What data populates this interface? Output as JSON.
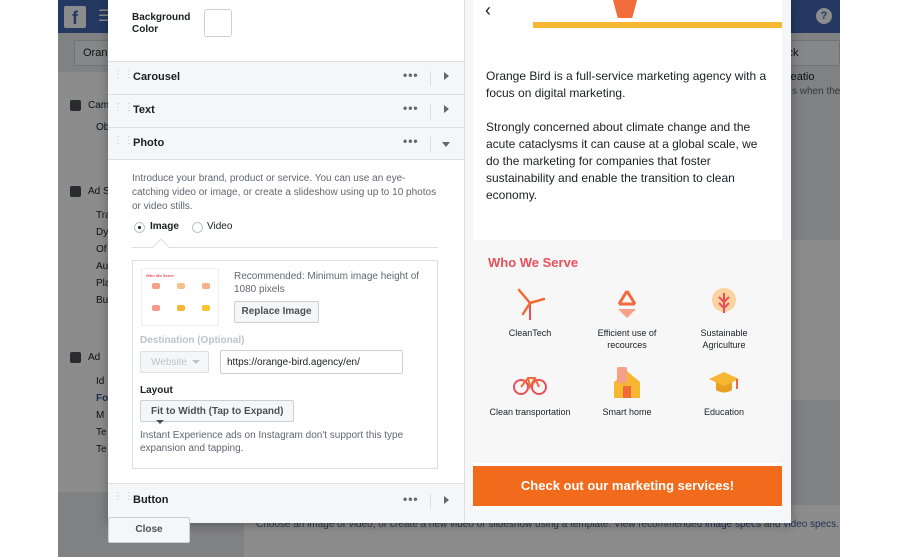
{
  "background": {
    "tab_label": "Orang",
    "quick_label": "uick Creatio",
    "side_items": [
      {
        "label": "Cam",
        "checked": true
      },
      {
        "label": "Ob",
        "checked": false
      },
      {
        "label": "Ad S",
        "checked": true
      },
      {
        "label": "Tra",
        "checked": false
      },
      {
        "label": "Dy",
        "checked": false
      },
      {
        "label": "Of",
        "checked": false
      },
      {
        "label": "Au",
        "checked": false
      },
      {
        "label": "Pla",
        "checked": false
      },
      {
        "label": "Bu",
        "checked": false
      },
      {
        "label": "Ad",
        "checked": true
      },
      {
        "label": "Id",
        "checked": false
      },
      {
        "label": "Fo",
        "checked": false
      },
      {
        "label": "M",
        "checked": false
      },
      {
        "label": "Te",
        "checked": false
      },
      {
        "label": "Te",
        "checked": false
      }
    ],
    "right_snippet": "s when the",
    "bottom_text": "Choose an image or video, or create a new video or slideshow using a template. View recommended ",
    "bottom_link1": "image specs",
    "bottom_and": " and ",
    "bottom_link2": "video specs",
    "bottom_end": "."
  },
  "editor": {
    "background_color_label": "Background Color",
    "background_color_value": "#ffffff",
    "sections": {
      "carousel": "Carousel",
      "text": "Text",
      "photo": "Photo",
      "button": "Button"
    },
    "more_glyph": "•••",
    "photo": {
      "description": "Introduce your brand, product or service. You can use an eye-catching video or image, or create a slideshow using up to 10 photos or video stills.",
      "media_types": [
        {
          "label": "Image",
          "selected": true
        },
        {
          "label": "Video",
          "selected": false
        }
      ],
      "thumbnail_title": "Who We Serve",
      "recommended": "Recommended: Minimum image height of 1080 pixels",
      "replace_button": "Replace Image",
      "destination_label": "Destination (Optional)",
      "destination_select": "Website",
      "destination_url": "https://orange-bird.agency/en/",
      "layout_label": "Layout",
      "layout_select": "Fit to Width (Tap to Expand)",
      "layout_note": "Instant Experience ads on Instagram don't support this type expansion and tapping."
    },
    "close_button": "Close"
  },
  "preview": {
    "back_glyph": "‹",
    "intro_p1": "Orange Bird is a full-service marketing agency with a focus on digital marketing.",
    "intro_p2": "Strongly concerned about climate change and the acute cataclysms it can cause at a global scale, we do the marketing for companies that foster sustainability and enable the transition to clean economy.",
    "serve_title": "Who We Serve",
    "serve_items": [
      {
        "label": "CleanTech",
        "icon": "wind-turbine-icon"
      },
      {
        "label": "Efficient use of recources",
        "icon": "recycle-icon"
      },
      {
        "label": "Sustainable Agriculture",
        "icon": "wheat-icon"
      },
      {
        "label": "Clean transportation",
        "icon": "bicycle-icon"
      },
      {
        "label": "Smart home",
        "icon": "smart-home-icon"
      },
      {
        "label": "Education",
        "icon": "graduation-cap-icon"
      }
    ],
    "cta": "Check out our marketing services!",
    "colors": {
      "accent": "#f26a1b",
      "title": "#e94f5a"
    }
  }
}
